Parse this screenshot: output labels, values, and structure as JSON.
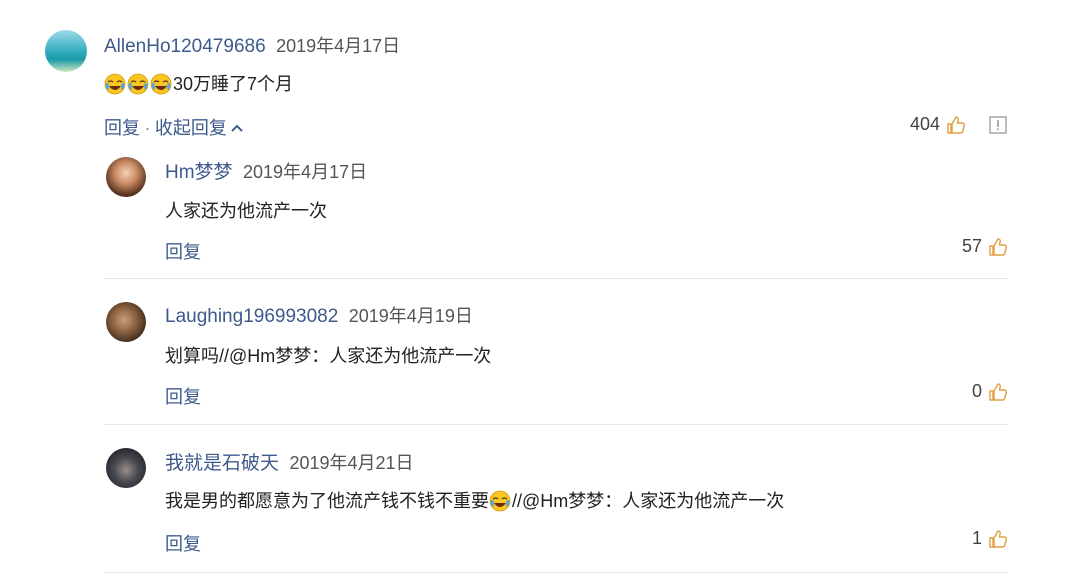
{
  "comment": {
    "username": "AllenHo120479686",
    "date": "2019年4月17日",
    "text": "30万睡了7个月",
    "emoji_icon": "crying-laughing-emoji-icon",
    "reply_label": "回复",
    "separator": "·",
    "collapse_label": "收起回复",
    "likes": "404",
    "report_icon": "report-icon"
  },
  "replies": [
    {
      "username": "Hm梦梦",
      "date": "2019年4月17日",
      "text": "人家还为他流产一次",
      "reply_label": "回复",
      "likes": "57"
    },
    {
      "username": "Laughing196993082",
      "date": "2019年4月19日",
      "text": "划算吗//@Hm梦梦：人家还为他流产一次",
      "reply_label": "回复",
      "likes": "0"
    },
    {
      "username": "我就是石破天",
      "date": "2019年4月21日",
      "text_before": "我是男的都愿意为了他流产钱不钱不重要",
      "text_after": "//@Hm梦梦：人家还为他流产一次",
      "reply_label": "回复",
      "likes": "1"
    }
  ],
  "colors": {
    "link": "#3e5a8c",
    "divider": "#e8e8e8",
    "like_icon": "#e0a040"
  }
}
